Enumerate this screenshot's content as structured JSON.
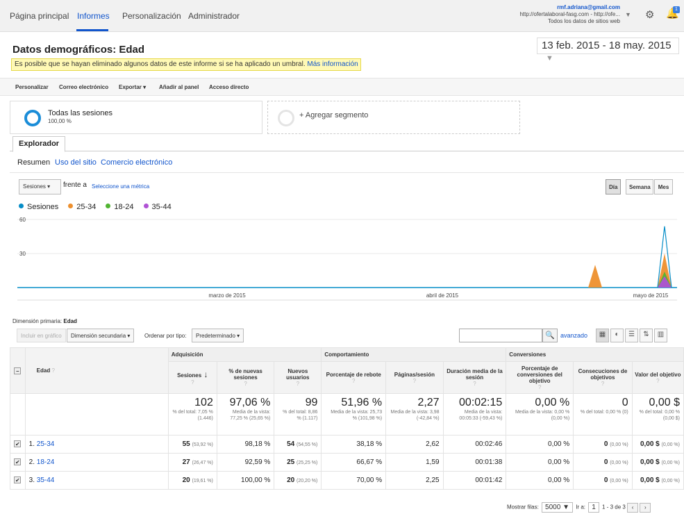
{
  "nav": {
    "items": [
      "Página principal",
      "Informes",
      "Personalización",
      "Administrador"
    ],
    "active": "Informes",
    "account_email": "rmf.adriana@gmail.com",
    "account_property": "http://ofertalaboral-fasg.com - http://ofe...",
    "account_view": "Todos los datos de sitios web",
    "notification_count": "1"
  },
  "page": {
    "title": "Datos demográficos: Edad",
    "date_start": "13 feb. 2015",
    "date_end": "18 may. 2015",
    "warning_text": "Es posible que se hayan eliminado algunos datos de este informe si se ha aplicado un umbral.",
    "warning_link": "Más información"
  },
  "toolbar": {
    "customize": "Personalizar",
    "email": "Correo electrónico",
    "export": "Exportar",
    "add_dashboard": "Añadir al panel",
    "shortcut": "Acceso directo"
  },
  "segments": {
    "all_name": "Todas las sesiones",
    "all_pct": "100,00 %",
    "add_label": "+ Agregar segmento"
  },
  "tabs": {
    "explorer": "Explorador",
    "subtabs": [
      "Resumen",
      "Uso del sitio",
      "Comercio electrónico"
    ]
  },
  "chart_controls": {
    "metric": "Sesiones",
    "vs": "frente a",
    "select_metric": "Seleccione una métrica",
    "granularity": [
      "Día",
      "Semana",
      "Mes"
    ]
  },
  "chart_data": {
    "type": "area",
    "series": [
      {
        "name": "Sesiones",
        "color": "#058dc7",
        "values": [
          0
        ]
      },
      {
        "name": "25-34",
        "color": "#ed8f2d",
        "values": [
          0
        ]
      },
      {
        "name": "18-24",
        "color": "#50b432",
        "values": [
          0
        ]
      },
      {
        "name": "35-44",
        "color": "#b052d5",
        "values": [
          0
        ]
      }
    ],
    "x_labels": [
      "marzo de 2015",
      "abril de 2015",
      "mayo de 2015"
    ],
    "y_ticks": [
      "60",
      "30"
    ],
    "ylim": [
      0,
      60
    ],
    "spikes": [
      {
        "date": "2015-05-07",
        "25-34": 20
      },
      {
        "date": "2015-05-17",
        "25-34": 30,
        "18-24": 14,
        "35-44": 10
      }
    ]
  },
  "table_controls": {
    "dim_label": "Dimensión primaria:",
    "dim_value": "Edad",
    "include_chart": "Incluir en gráfico",
    "secondary_dim": "Dimensión secundaria",
    "sort_label": "Ordenar por tipo:",
    "sort_value": "Predeterminado",
    "advanced": "avanzado"
  },
  "table": {
    "groups": [
      "Adquisición",
      "Comportamiento",
      "Conversiones"
    ],
    "dim_header": "Edad",
    "headers": [
      "Sesiones",
      "% de nuevas sesiones",
      "Nuevos usuarios",
      "Porcentaje de rebote",
      "Páginas/sesión",
      "Duración media de la sesión",
      "Porcentaje de conversiones del objetivo",
      "Consecuciones de objetivos",
      "Valor del objetivo"
    ],
    "totals": [
      {
        "big": "102",
        "sub": "% del total: 7,05 % (1.446)"
      },
      {
        "big": "97,06 %",
        "sub": "Media de la vista: 77,25 % (25,65 %)"
      },
      {
        "big": "99",
        "sub": "% del total: 8,86 % (1.117)"
      },
      {
        "big": "51,96 %",
        "sub": "Media de la vista: 25,73 % (101,98 %)"
      },
      {
        "big": "2,27",
        "sub": "Media de la vista: 3,98 (-42,84 %)"
      },
      {
        "big": "00:02:15",
        "sub": "Media de la vista: 00:05:33 (-59,43 %)"
      },
      {
        "big": "0,00 %",
        "sub": "Media de la vista: 0,00 % (0,00 %)"
      },
      {
        "big": "0",
        "sub": "% del total: 0,00 % (0)"
      },
      {
        "big": "0,00 $",
        "sub": "% del total: 0,00 % (0,00 $)"
      }
    ],
    "rows": [
      {
        "num": "1.",
        "name": "25-34",
        "sessions": "55",
        "sessions_pct": "(53,92 %)",
        "new_pct": "98,18 %",
        "new_users": "54",
        "new_users_pct": "(54,55 %)",
        "bounce": "38,18 %",
        "pages": "2,62",
        "duration": "00:02:46",
        "conv": "0,00 %",
        "goals": "0",
        "goals_pct": "(0,00 %)",
        "value": "0,00 $",
        "value_pct": "(0,00 %)"
      },
      {
        "num": "2.",
        "name": "18-24",
        "sessions": "27",
        "sessions_pct": "(26,47 %)",
        "new_pct": "92,59 %",
        "new_users": "25",
        "new_users_pct": "(25,25 %)",
        "bounce": "66,67 %",
        "pages": "1,59",
        "duration": "00:01:38",
        "conv": "0,00 %",
        "goals": "0",
        "goals_pct": "(0,00 %)",
        "value": "0,00 $",
        "value_pct": "(0,00 %)"
      },
      {
        "num": "3.",
        "name": "35-44",
        "sessions": "20",
        "sessions_pct": "(19,61 %)",
        "new_pct": "100,00 %",
        "new_users": "20",
        "new_users_pct": "(20,20 %)",
        "bounce": "70,00 %",
        "pages": "2,25",
        "duration": "00:01:42",
        "conv": "0,00 %",
        "goals": "0",
        "goals_pct": "(0,00 %)",
        "value": "0,00 $",
        "value_pct": "(0,00 %)"
      }
    ]
  },
  "pager": {
    "show_rows": "Mostrar filas:",
    "rows_value": "5000",
    "goto": "Ir a:",
    "page": "1",
    "range": "1 - 3 de 3"
  }
}
